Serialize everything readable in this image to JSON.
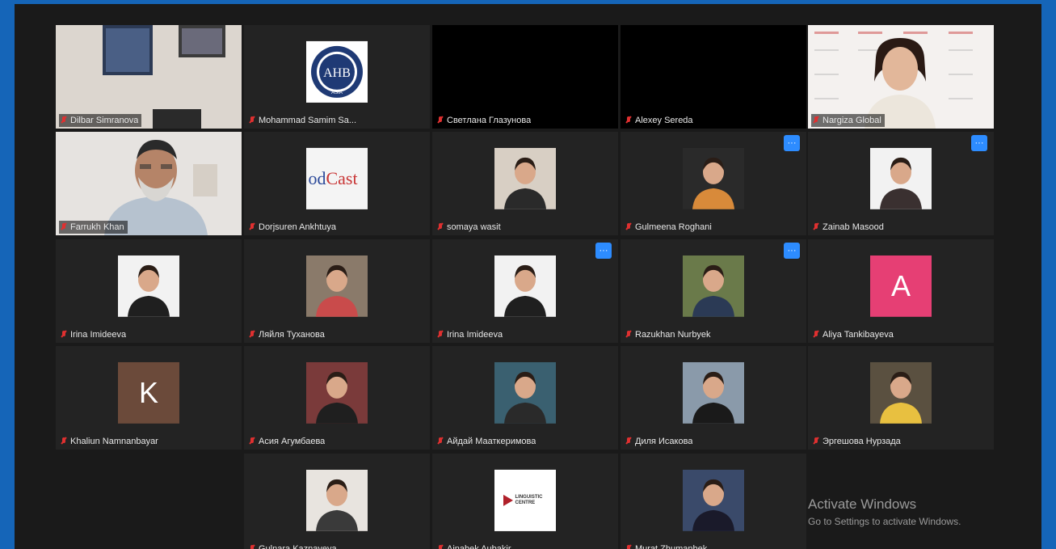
{
  "participants": [
    {
      "name": "Dilbar Simranova",
      "video": "room",
      "boxed": true
    },
    {
      "name": "Mohammad Samim Sa...",
      "video": "logo-circle",
      "logo_text": "AHB",
      "logo_sub": "ASIA"
    },
    {
      "name": "Светлана Глазунова",
      "video": "black"
    },
    {
      "name": "Alexey Sereda",
      "video": "black"
    },
    {
      "name": "Nargiza Global",
      "video": "woman-wall",
      "boxed": true
    },
    {
      "name": "Farrukh Khan",
      "video": "man",
      "boxed": true,
      "active": true
    },
    {
      "name": "Dorjsuren Ankhtuya",
      "video": "podcast",
      "logo_text": "odCast"
    },
    {
      "name": "somaya wasit",
      "video": "photo",
      "shirt": "#2a2a2a",
      "bg": "#d8cfc4"
    },
    {
      "name": "Gulmeena Roghani",
      "video": "photo",
      "shirt": "#d88a3a",
      "bg": "#2a2a2a",
      "more": true
    },
    {
      "name": "Zainab Masood",
      "video": "photo",
      "shirt": "#3a3030",
      "bg": "#f2f2f2",
      "more": true
    },
    {
      "name": "Irina Imideeva",
      "video": "photo",
      "shirt": "#1f1f1f",
      "bg": "#f2f2f2"
    },
    {
      "name": "Ляйля Туханова",
      "video": "photo",
      "shirt": "#c94b4b",
      "bg": "#8a7a6a"
    },
    {
      "name": "Irina Imideeva",
      "video": "photo",
      "shirt": "#1f1f1f",
      "bg": "#f2f2f2",
      "more": true
    },
    {
      "name": "Razukhan Nurbyek",
      "video": "photo",
      "shirt": "#2b3a55",
      "bg": "#6a7a4a",
      "more": true
    },
    {
      "name": "Aliya Tankibayeva",
      "video": "letter",
      "letter": "A",
      "letter_color": "#e63f74"
    },
    {
      "name": "Khaliun Namnanbayar",
      "video": "letter",
      "letter": "K",
      "letter_color": "#6b4a3a"
    },
    {
      "name": "Асия Агумбаева",
      "video": "photo",
      "shirt": "#1f1f1f",
      "bg": "#7a3a3a"
    },
    {
      "name": "Айдай Мааткеримова",
      "video": "photo",
      "shirt": "#2a2a2a",
      "bg": "#3a6070"
    },
    {
      "name": "Диля Исакова",
      "video": "photo",
      "shirt": "#1a1a1a",
      "bg": "#8a9aaa"
    },
    {
      "name": "Эргешова Нурзада",
      "video": "photo",
      "shirt": "#e8c040",
      "bg": "#5a5040"
    },
    {
      "name": "Gulnara Kaznayeva",
      "video": "photo",
      "shirt": "#3a3a3a",
      "bg": "#e8e4df"
    },
    {
      "name": "Ainabek Aubakir",
      "video": "logo-linguistic",
      "logo_text": "LINGUISTIC CENTRE"
    },
    {
      "name": "Murat Zhumanbek",
      "video": "photo",
      "shirt": "#1a1a2a",
      "bg": "#3a4a6a"
    }
  ],
  "more_label": "···",
  "watermark": {
    "title": "Activate Windows",
    "subtitle": "Go to Settings to activate Windows."
  },
  "colors": {
    "frame": "#1565b8",
    "tile": "#232323",
    "active_outline": "#9bd36a",
    "muted_mic": "#e03030",
    "more_button": "#2d8cff"
  }
}
